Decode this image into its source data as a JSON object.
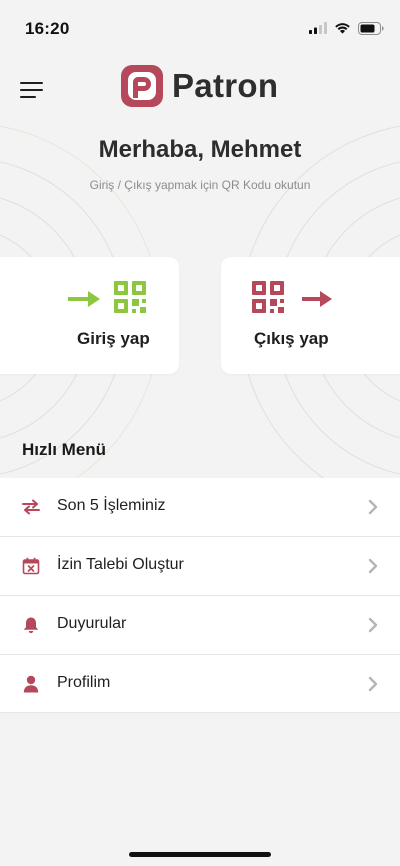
{
  "status_bar": {
    "time": "16:20",
    "icons": [
      "cellular-signal-icon",
      "wifi-icon",
      "battery-icon"
    ]
  },
  "header": {
    "menu_icon": "hamburger-menu-icon",
    "logo_icon": "patron-logo-icon",
    "app_name": "Patron"
  },
  "greeting": {
    "title": "Merhaba, Mehmet",
    "subtitle": "Giriş / Çıkış yapmak için QR Kodu okutun"
  },
  "actions": {
    "check_in": {
      "label": "Giriş yap",
      "icon": "arrow-right-qr-code-icon",
      "color": "#8dc63f"
    },
    "check_out": {
      "label": "Çıkış yap",
      "icon": "qr-code-arrow-right-icon",
      "color": "#b5495b"
    }
  },
  "quick_menu": {
    "title": "Hızlı Menü",
    "items": [
      {
        "label": "Son 5 İşleminiz",
        "icon": "swap-arrows-icon"
      },
      {
        "label": "İzin Talebi Oluştur",
        "icon": "calendar-x-icon"
      },
      {
        "label": "Duyurular",
        "icon": "bell-icon"
      },
      {
        "label": "Profilim",
        "icon": "user-icon"
      }
    ]
  },
  "colors": {
    "brand": "#b5495b",
    "accent_green": "#8dc63f",
    "background": "#f3f3f3"
  }
}
